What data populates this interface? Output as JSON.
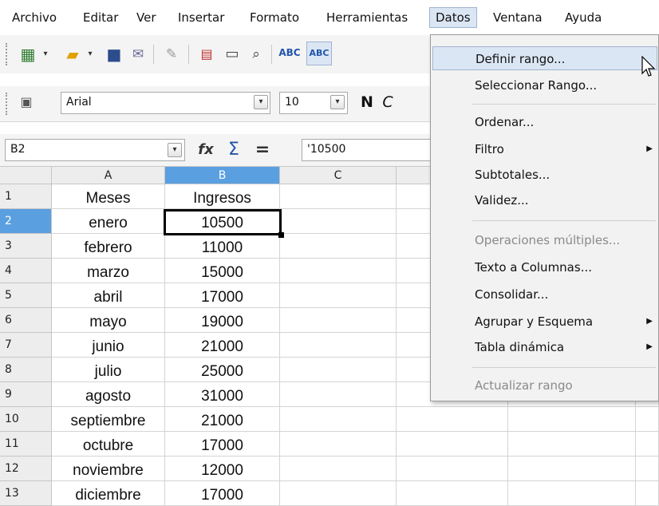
{
  "menu": {
    "archivo": "Archivo",
    "editar": "Editar",
    "ver": "Ver",
    "insertar": "Insertar",
    "formato": "Formato",
    "herramientas": "Herramientas",
    "datos": "Datos",
    "ventana": "Ventana",
    "ayuda": "Ayuda"
  },
  "format_toolbar": {
    "font_name": "Arial",
    "font_size": "10",
    "bold_label": "N",
    "italic_label": "C"
  },
  "formula_bar": {
    "name_box": "B2",
    "content": "'10500",
    "wizard_glyph": "fx",
    "sum_glyph": "Σ",
    "equals_glyph": "="
  },
  "sheet": {
    "columns": [
      "A",
      "B",
      "C"
    ],
    "rows": [
      {
        "n": "1",
        "a": "Meses",
        "b": "Ingresos"
      },
      {
        "n": "2",
        "a": "enero",
        "b": "10500"
      },
      {
        "n": "3",
        "a": "febrero",
        "b": "11000"
      },
      {
        "n": "4",
        "a": "marzo",
        "b": "15000"
      },
      {
        "n": "5",
        "a": "abril",
        "b": "17000"
      },
      {
        "n": "6",
        "a": "mayo",
        "b": "19000"
      },
      {
        "n": "7",
        "a": "junio",
        "b": "21000"
      },
      {
        "n": "8",
        "a": "julio",
        "b": "25000"
      },
      {
        "n": "9",
        "a": "agosto",
        "b": "31000"
      },
      {
        "n": "10",
        "a": "septiembre",
        "b": "21000"
      },
      {
        "n": "11",
        "a": "octubre",
        "b": "17000"
      },
      {
        "n": "12",
        "a": "noviembre",
        "b": "12000"
      },
      {
        "n": "13",
        "a": "diciembre",
        "b": "17000"
      }
    ]
  },
  "datos_menu": {
    "definir_rango": "Definir rango...",
    "seleccionar_rango": "Seleccionar Rango...",
    "ordenar": "Ordenar...",
    "filtro": "Filtro",
    "subtotales": "Subtotales...",
    "validez": "Validez...",
    "operaciones_multiples": "Operaciones múltiples...",
    "texto_a_columnas": "Texto a Columnas...",
    "consolidar": "Consolidar...",
    "agrupar_esquema": "Agrupar y Esquema",
    "tabla_dinamica": "Tabla dinámica",
    "actualizar_rango": "Actualizar rango"
  },
  "colors": {
    "selection_header": "#5a9fe0",
    "menu_highlight": "#dbe6f4"
  }
}
